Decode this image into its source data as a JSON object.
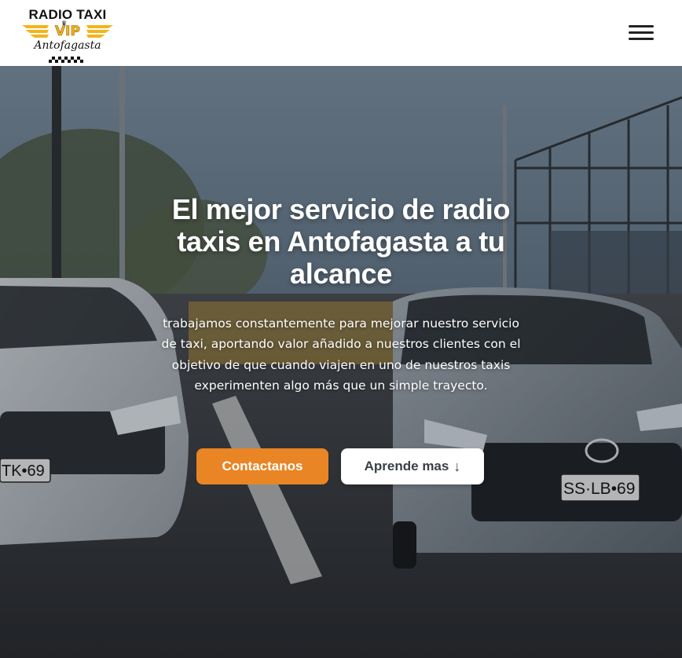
{
  "header": {
    "logo": {
      "line1": "RADIO TAXI",
      "line2": "VIP",
      "line3": "Antofagasta"
    },
    "menu_icon": "hamburger-menu-icon"
  },
  "hero": {
    "title": "El mejor servicio de radio taxis en Antofagasta a tu alcance",
    "text": "trabajamos constantemente para mejorar nuestro servicio de taxi, aportando valor añadido a nuestros clientes con el objetivo de que cuando viajen en uno de nuestros taxis experimenten algo más que un simple trayecto.",
    "primary_button": "Contactanos",
    "secondary_button": "Aprende mas",
    "secondary_button_icon": "↓",
    "plate_left": "TK•69",
    "plate_right": "SS·LB•69"
  },
  "colors": {
    "accent": "#e98524",
    "logo_gold": "#f3b41b"
  }
}
